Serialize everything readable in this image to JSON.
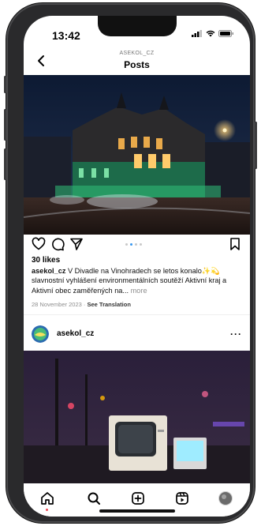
{
  "status_bar": {
    "time": "13:42"
  },
  "header": {
    "username": "ASEKOL_CZ",
    "title": "Posts",
    "back_icon": "chevron-left-icon"
  },
  "post1": {
    "likes": "30 likes",
    "caption_user": "asekol_cz",
    "caption_text": " V Divadle na Vinohradech se letos konalo✨💫 slavnostní vyhlášení  environmentálních soutěží Aktivní kraj a Aktivní obec zaměřených na...",
    "more_label": " more",
    "date": "28 November 2023",
    "see_translation": "See Translation",
    "carousel_total": 4,
    "carousel_active": 2
  },
  "post2": {
    "username": "asekol_cz",
    "more_icon": "ellipsis-icon"
  },
  "tabs": [
    "home-icon",
    "search-icon",
    "create-icon",
    "reels-icon",
    "profile-avatar"
  ],
  "colors": {
    "accent": "#3897f0",
    "notification": "#ed4956"
  }
}
